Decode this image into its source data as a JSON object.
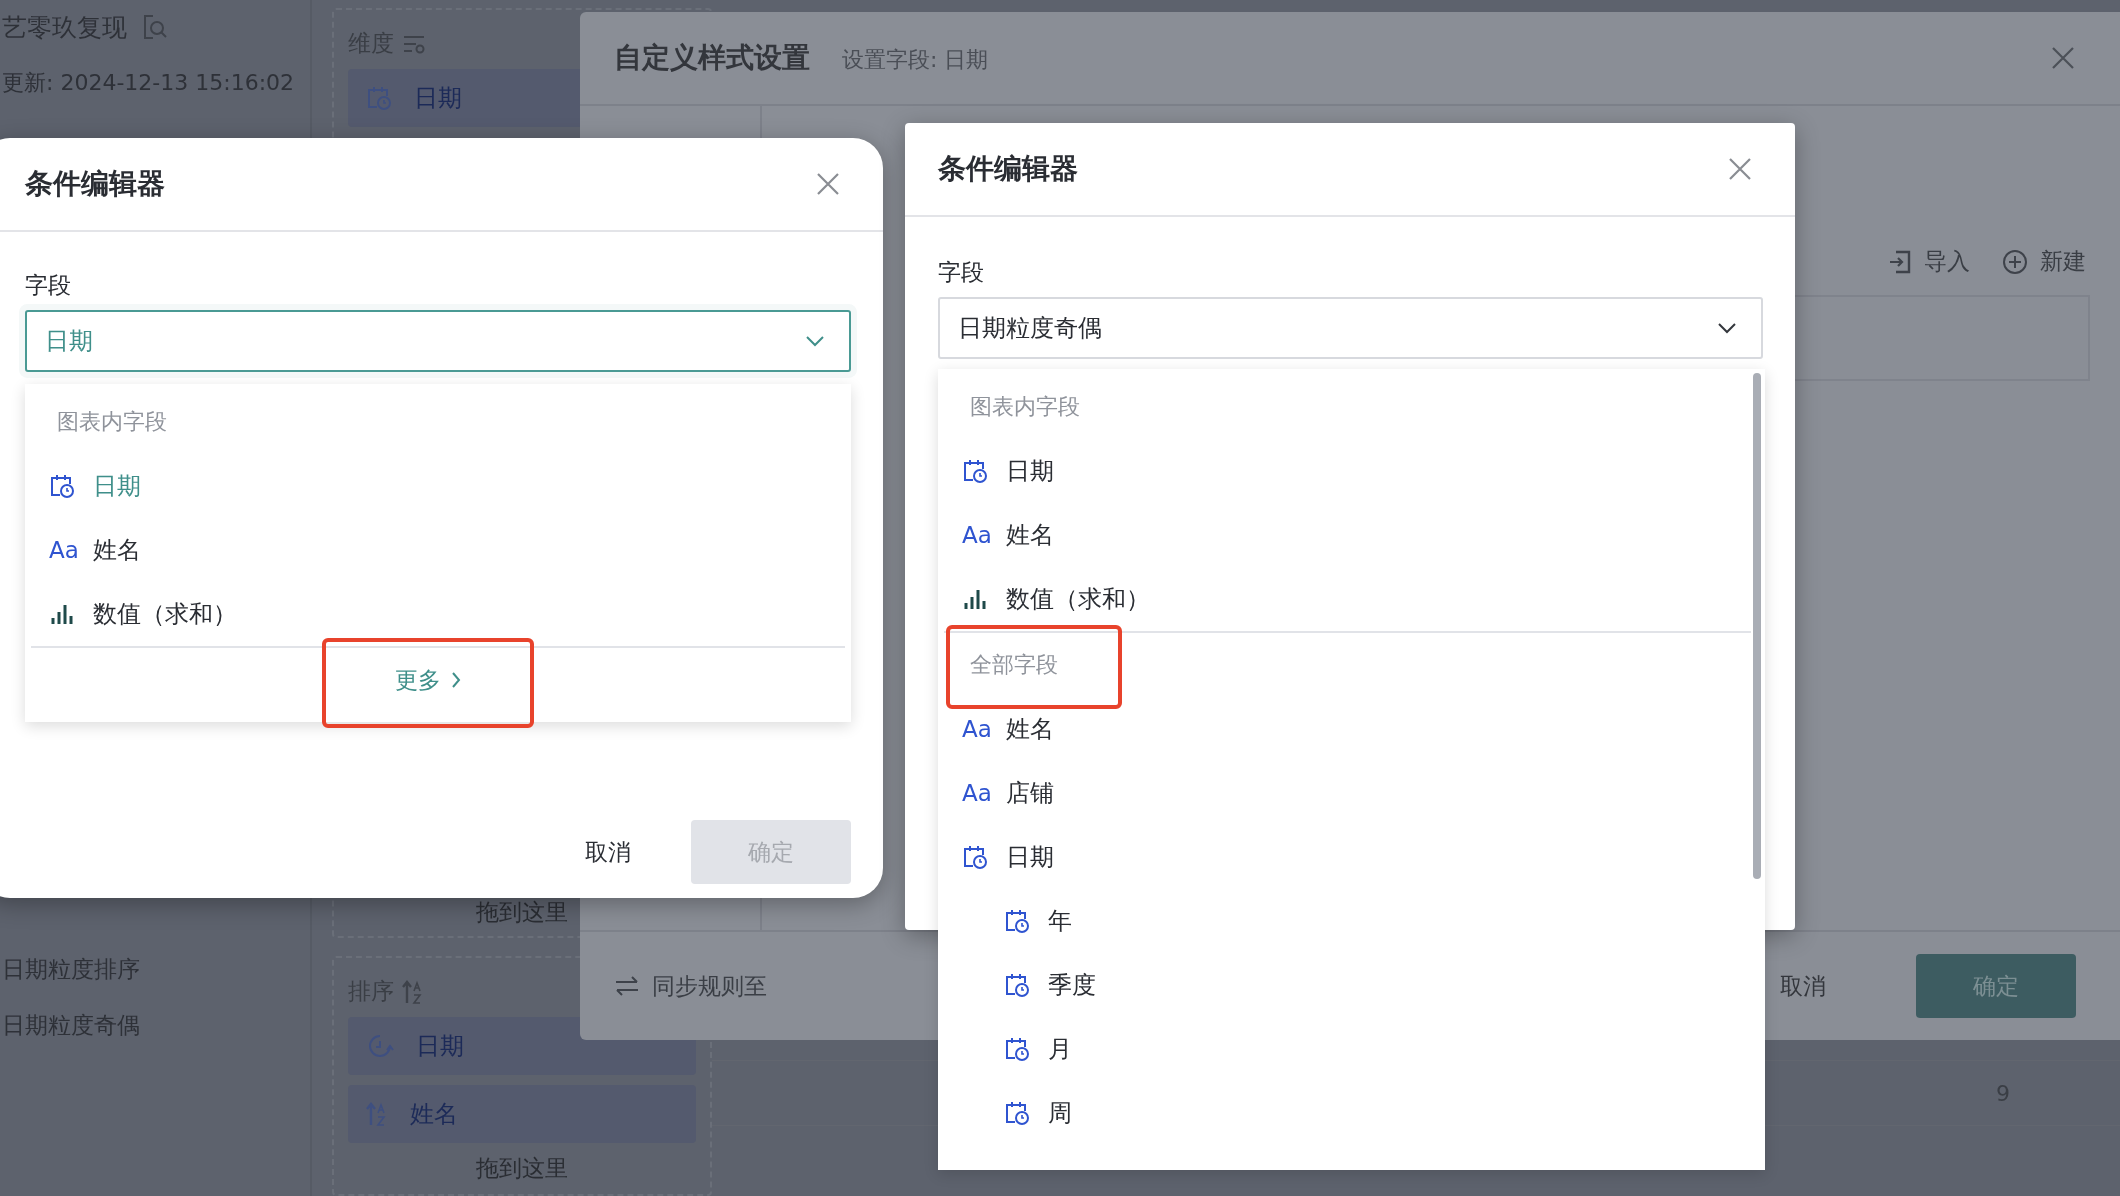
{
  "background": {
    "report_title": "艺零玖复现",
    "updated": "更新: 2024-12-13 15:16:02",
    "fields": [
      "日期粒度排序",
      "日期粒度奇偶"
    ],
    "dimension": {
      "label": "维度",
      "chips": [
        {
          "kind": "date",
          "label": "日期"
        }
      ],
      "drop_hint": "拖到这里"
    },
    "sort": {
      "label": "排序",
      "chips": [
        {
          "kind": "cycle",
          "label": "日期"
        },
        {
          "kind": "sort",
          "label": "姓名"
        }
      ],
      "drop_hint": "拖到这里"
    },
    "table_value": "9"
  },
  "style_dialog": {
    "title": "自定义样式设置",
    "subtitle": "设置字段: 日期",
    "actions": [
      {
        "kind": "import",
        "label": "导入"
      },
      {
        "kind": "new",
        "label": "新建"
      }
    ],
    "sync": "同步规则至",
    "cancel": "取消",
    "confirm": "确定"
  },
  "left_editor": {
    "title": "条件编辑器",
    "field_label": "字段",
    "value": "日期",
    "focused": true,
    "groups": [
      {
        "header": "图表内字段",
        "highlighted": false,
        "items": [
          {
            "kind": "date",
            "label": "日期",
            "selected": true
          },
          {
            "kind": "text",
            "icon": "Aa",
            "label": "姓名",
            "selected": false
          },
          {
            "kind": "measure",
            "label": "数值（求和）",
            "selected": false
          }
        ]
      }
    ],
    "more": {
      "label": "更多",
      "highlighted": true
    },
    "cancel": "取消",
    "confirm": "确定",
    "confirm_disabled": true
  },
  "right_editor": {
    "title": "条件编辑器",
    "field_label": "字段",
    "value": "日期粒度奇偶",
    "focused": false,
    "groups": [
      {
        "header": "图表内字段",
        "highlighted": false,
        "items": [
          {
            "kind": "date",
            "label": "日期",
            "selected": false
          },
          {
            "kind": "text",
            "icon": "Aa",
            "label": "姓名",
            "selected": false
          },
          {
            "kind": "measure",
            "label": "数值（求和）",
            "selected": false
          }
        ]
      },
      {
        "header": "全部字段",
        "highlighted": true,
        "items": [
          {
            "kind": "text",
            "icon": "Aa",
            "label": "姓名",
            "selected": false
          },
          {
            "kind": "text",
            "icon": "Aa",
            "label": "店铺",
            "selected": false
          },
          {
            "kind": "date",
            "label": "日期",
            "selected": false,
            "children": [
              {
                "kind": "date",
                "label": "年",
                "selected": false
              },
              {
                "kind": "date",
                "label": "季度",
                "selected": false
              },
              {
                "kind": "date",
                "label": "月",
                "selected": false
              },
              {
                "kind": "date",
                "label": "周",
                "selected": false
              }
            ]
          }
        ]
      }
    ]
  }
}
